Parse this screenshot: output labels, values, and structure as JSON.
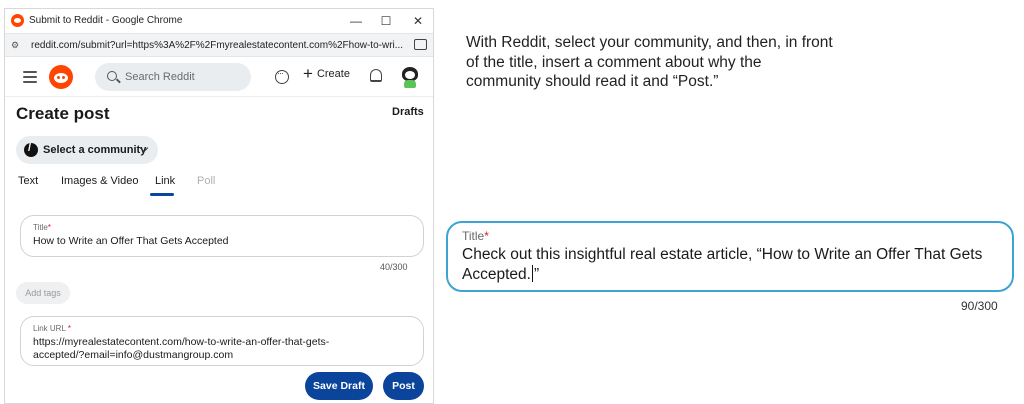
{
  "browser": {
    "window_title": "Submit to Reddit - Google Chrome",
    "url": "reddit.com/submit?url=https%3A%2F%2Fmyrealestatecontent.com%2Fhow-to-wri...",
    "controls": {
      "minimize": "—",
      "maximize": "☐",
      "close": "✕"
    }
  },
  "header": {
    "search_placeholder": "Search Reddit",
    "create_label": "Create",
    "icons": [
      "menu-icon",
      "reddit-logo",
      "search-icon",
      "chat-icon",
      "plus-icon",
      "bell-icon",
      "avatar"
    ]
  },
  "page": {
    "title": "Create post",
    "drafts_label": "Drafts",
    "community_label": "Select a community",
    "tabs": [
      {
        "label": "Text",
        "active": false,
        "disabled": false
      },
      {
        "label": "Images & Video",
        "active": false,
        "disabled": false
      },
      {
        "label": "Link",
        "active": true,
        "disabled": false
      },
      {
        "label": "Poll",
        "active": false,
        "disabled": true
      }
    ],
    "title_field": {
      "label": "Title",
      "required_mark": "*",
      "value": "How to Write an Offer That Gets Accepted",
      "counter": "40/300"
    },
    "tags_label": "Add tags",
    "link_field": {
      "label": "Link URL",
      "required_mark": "*",
      "value_line1": "https://myrealestatecontent.com/how-to-write-an-offer-that-gets-",
      "value_line2": "accepted/?email=info@dustmangroup.com"
    },
    "save_draft_label": "Save Draft",
    "post_label": "Post"
  },
  "instructions": {
    "line1": "With Reddit, select your community, and then, in front",
    "line2": "of the title, insert a comment about why the",
    "line3": "community should read it and “Post.”"
  },
  "zoomed_title": {
    "label": "Title",
    "required_mark": "*",
    "value_before_caret": "Check out this insightful real estate article, “How to Write an Offer That Gets Accepted.",
    "value_after_caret": "”",
    "counter": "90/300"
  },
  "colors": {
    "reddit_orange": "#ff4500",
    "primary_button": "#0a449b",
    "highlight_border": "#3ea3d3",
    "required": "#e0162b"
  }
}
